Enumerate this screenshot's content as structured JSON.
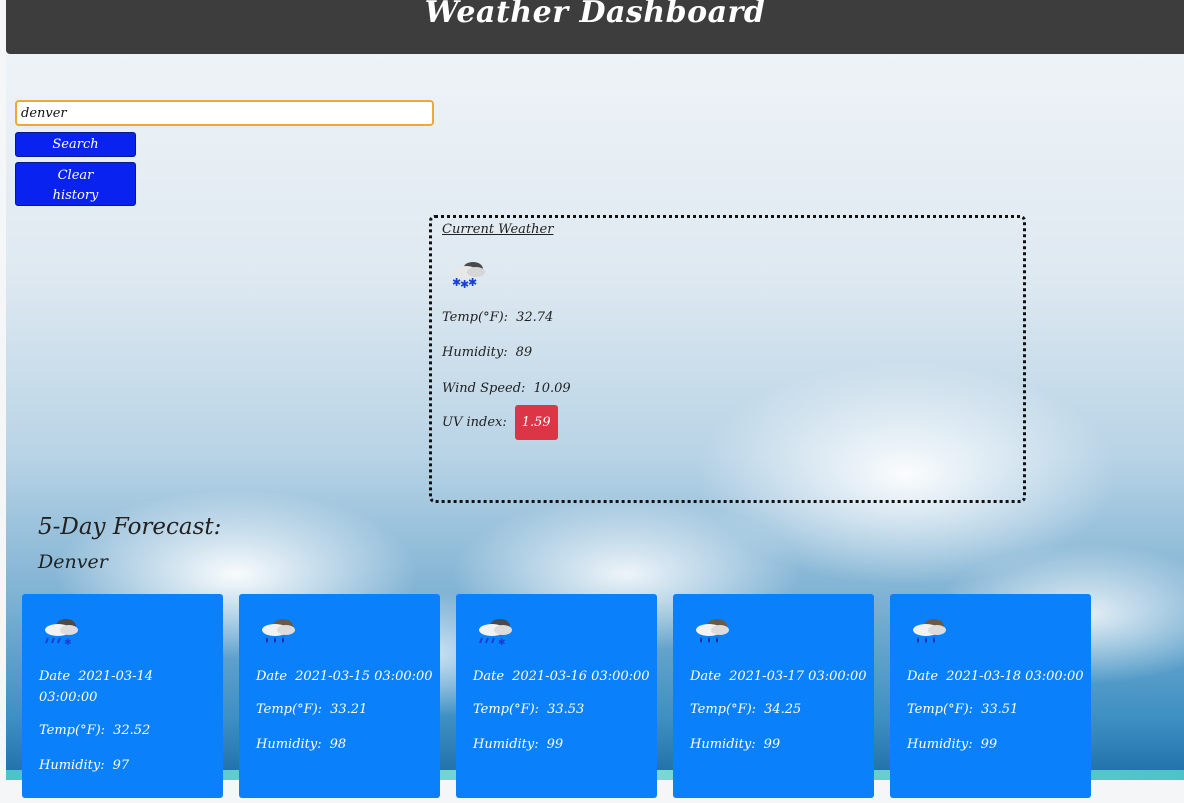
{
  "header": {
    "title": "Weather Dashboard"
  },
  "search": {
    "value": "denver",
    "button_label": "Search",
    "clear_label_line1": "Clear",
    "clear_label_line2": "history"
  },
  "current": {
    "title": "Current Weather",
    "icon": "snow-cloud-icon",
    "temp_label": "Temp(°F):",
    "temp_value": "32.74",
    "humidity_label": "Humidity:",
    "humidity_value": "89",
    "wind_label": "Wind Speed:",
    "wind_value": "10.09",
    "uv_label": "UV index:",
    "uv_value": "1.59",
    "uv_color": "#dc3545"
  },
  "forecast": {
    "title": "5-Day Forecast:",
    "city": "Denver",
    "days": [
      {
        "icon": "rain-snow-cloud-icon",
        "date_label": "Date",
        "date_line1": "2021-03-14",
        "date_line2": "03:00:00",
        "temp_label": "Temp(°F):",
        "temp_value": "32.52",
        "humidity_label": "Humidity:",
        "humidity_value": "97"
      },
      {
        "icon": "rain-cloud-icon",
        "date_label": "Date",
        "date_line1": "2021-03-15 03:00:00",
        "date_line2": "",
        "temp_label": "Temp(°F):",
        "temp_value": "33.21",
        "humidity_label": "Humidity:",
        "humidity_value": "98"
      },
      {
        "icon": "rain-snow-cloud-icon",
        "date_label": "Date",
        "date_line1": "2021-03-16 03:00:00",
        "date_line2": "",
        "temp_label": "Temp(°F):",
        "temp_value": "33.53",
        "humidity_label": "Humidity:",
        "humidity_value": "99"
      },
      {
        "icon": "rain-cloud-icon",
        "date_label": "Date",
        "date_line1": "2021-03-17 03:00:00",
        "date_line2": "",
        "temp_label": "Temp(°F):",
        "temp_value": "34.25",
        "humidity_label": "Humidity:",
        "humidity_value": "99"
      },
      {
        "icon": "rain-cloud-icon",
        "date_label": "Date",
        "date_line1": "2021-03-18 03:00:00",
        "date_line2": "",
        "temp_label": "Temp(°F):",
        "temp_value": "33.51",
        "humidity_label": "Humidity:",
        "humidity_value": "99"
      }
    ],
    "card_color": "#0a80fb"
  }
}
